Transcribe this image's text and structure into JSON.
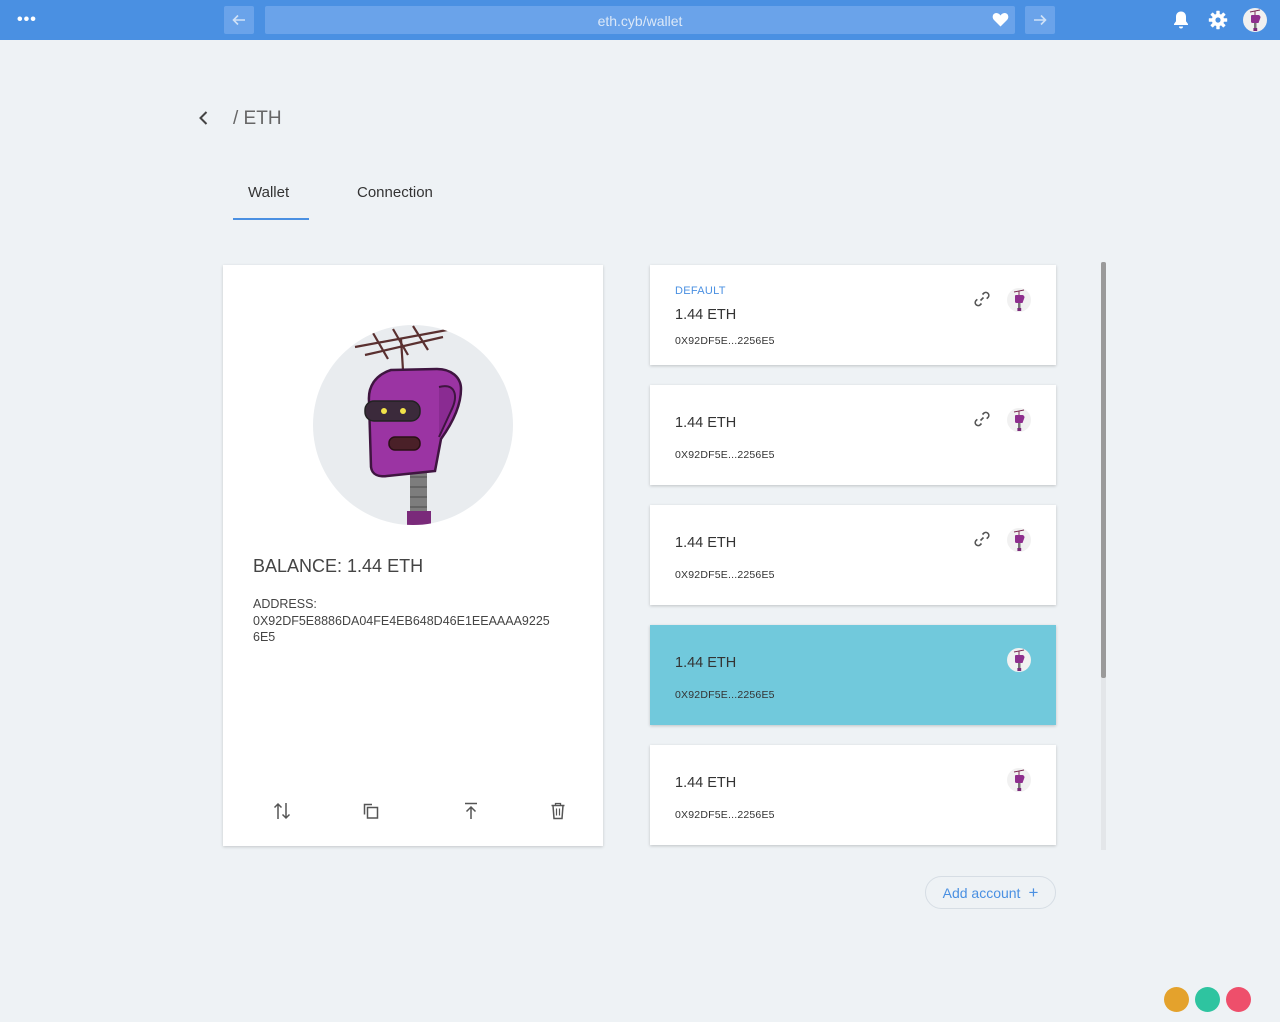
{
  "topbar": {
    "menu_label": "•••",
    "url": "eth.cyb/wallet",
    "icons": {
      "menu": "menu-dots-icon",
      "back": "arrow-left-icon",
      "forward": "arrow-right-icon",
      "favorite": "heart-icon",
      "notifications": "bell-icon",
      "settings": "gear-icon",
      "profile": "avatar"
    }
  },
  "header": {
    "title": "/ ETH",
    "back_icon": "chevron-left-icon"
  },
  "tabs": [
    {
      "label": "Wallet",
      "active": true
    },
    {
      "label": "Connection",
      "active": false
    }
  ],
  "wallet": {
    "balance": "BALANCE: 1.44 ETH",
    "address_label": "ADDRESS:",
    "address": "0X92DF5E8886DA04FE4EB648D46E1EEAAAA92256E5",
    "actions": [
      {
        "icon": "transfer-icon"
      },
      {
        "icon": "copy-icon"
      },
      {
        "icon": "upload-icon"
      },
      {
        "icon": "trash-icon"
      }
    ]
  },
  "accounts": [
    {
      "tag": "DEFAULT",
      "amount": "1.44 ETH",
      "address": "0X92DF5E...2256E5",
      "linked": true,
      "selected": false
    },
    {
      "amount": "1.44 ETH",
      "address": "0X92DF5E...2256E5",
      "linked": true,
      "selected": false
    },
    {
      "amount": "1.44 ETH",
      "address": "0X92DF5E...2256E5",
      "linked": true,
      "selected": false
    },
    {
      "amount": "1.44 ETH",
      "address": "0X92DF5E...2256E5",
      "linked": false,
      "selected": true
    },
    {
      "amount": "1.44 ETH",
      "address": "0X92DF5E...2256E5",
      "linked": false,
      "selected": false
    }
  ],
  "add_account": {
    "label": "Add account",
    "plus": "+"
  },
  "colors": {
    "topbar": "#4a90e2",
    "accent": "#4a90e2",
    "selected_row": "#71c9dc",
    "dot_1": "#e4a22c",
    "dot_2": "#2ec4a0",
    "dot_3": "#ee4f6b"
  }
}
